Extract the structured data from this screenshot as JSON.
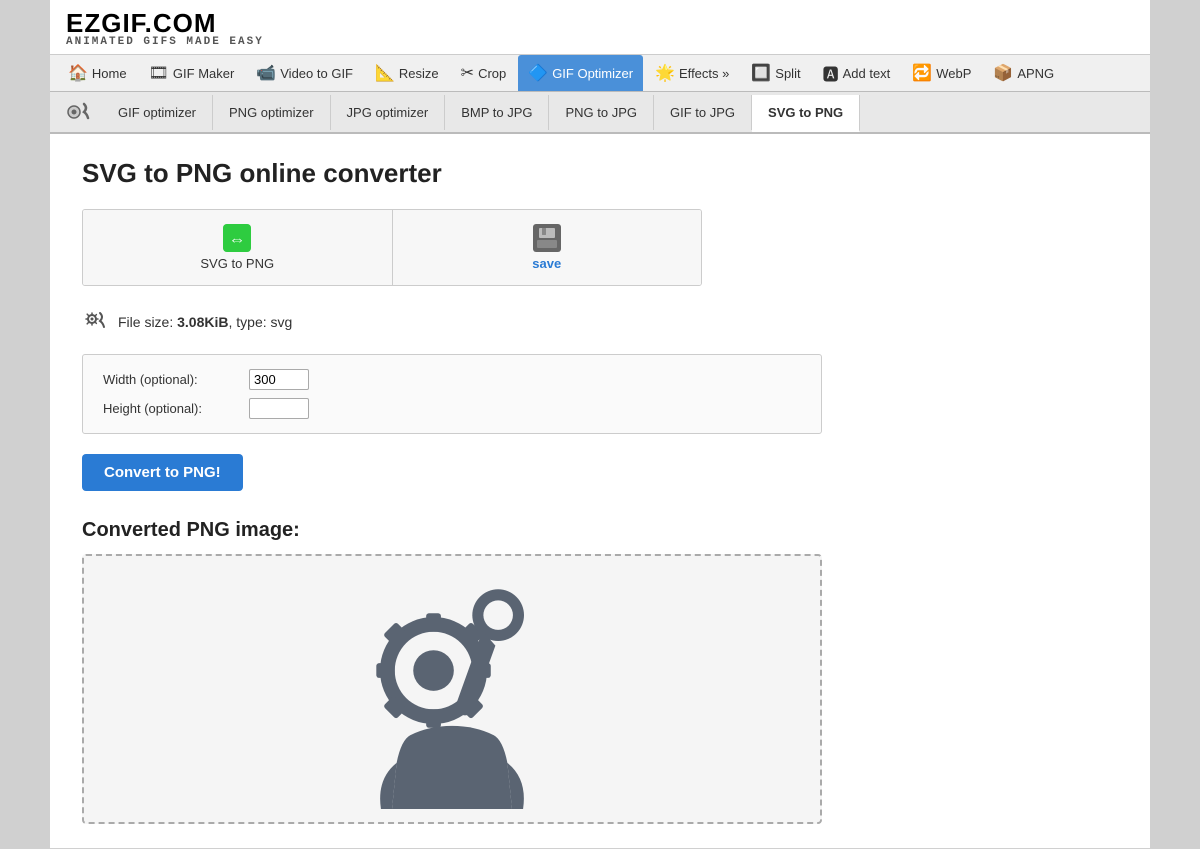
{
  "header": {
    "logo_main": "EZGIF.COM",
    "logo_sub": "ANIMATED GIFS MADE EASY"
  },
  "nav": {
    "items": [
      {
        "label": "Home",
        "icon": "🏠",
        "active": false
      },
      {
        "label": "GIF Maker",
        "icon": "🎞",
        "active": false
      },
      {
        "label": "Video to GIF",
        "icon": "📹",
        "active": false
      },
      {
        "label": "Resize",
        "icon": "📐",
        "active": false
      },
      {
        "label": "Crop",
        "icon": "✂",
        "active": false
      },
      {
        "label": "GIF Optimizer",
        "icon": "🔷",
        "active": true
      },
      {
        "label": "Effects »",
        "icon": "🌟",
        "active": false
      },
      {
        "label": "Split",
        "icon": "🔲",
        "active": false
      },
      {
        "label": "Add text",
        "icon": "🅰",
        "active": false
      },
      {
        "label": "WebP",
        "icon": "🔁",
        "active": false
      },
      {
        "label": "APNG",
        "icon": "📦",
        "active": false
      }
    ]
  },
  "subnav": {
    "items": [
      {
        "label": "GIF optimizer",
        "active": false
      },
      {
        "label": "PNG optimizer",
        "active": false
      },
      {
        "label": "JPG optimizer",
        "active": false
      },
      {
        "label": "BMP to JPG",
        "active": false
      },
      {
        "label": "PNG to JPG",
        "active": false
      },
      {
        "label": "GIF to JPG",
        "active": false
      },
      {
        "label": "SVG to PNG",
        "active": true
      }
    ]
  },
  "main": {
    "page_title": "SVG to PNG online converter",
    "tool_buttons": [
      {
        "label": "SVG to PNG",
        "type": "convert"
      },
      {
        "label": "save",
        "type": "save"
      }
    ],
    "file_info": {
      "prefix": "File size: ",
      "size": "3.08KiB",
      "suffix": ", type: svg"
    },
    "options": [
      {
        "label": "Width (optional):",
        "value": "300",
        "placeholder": ""
      },
      {
        "label": "Height (optional):",
        "value": "",
        "placeholder": ""
      }
    ],
    "convert_button_label": "Convert to PNG!",
    "converted_section_title": "Converted PNG image:"
  }
}
